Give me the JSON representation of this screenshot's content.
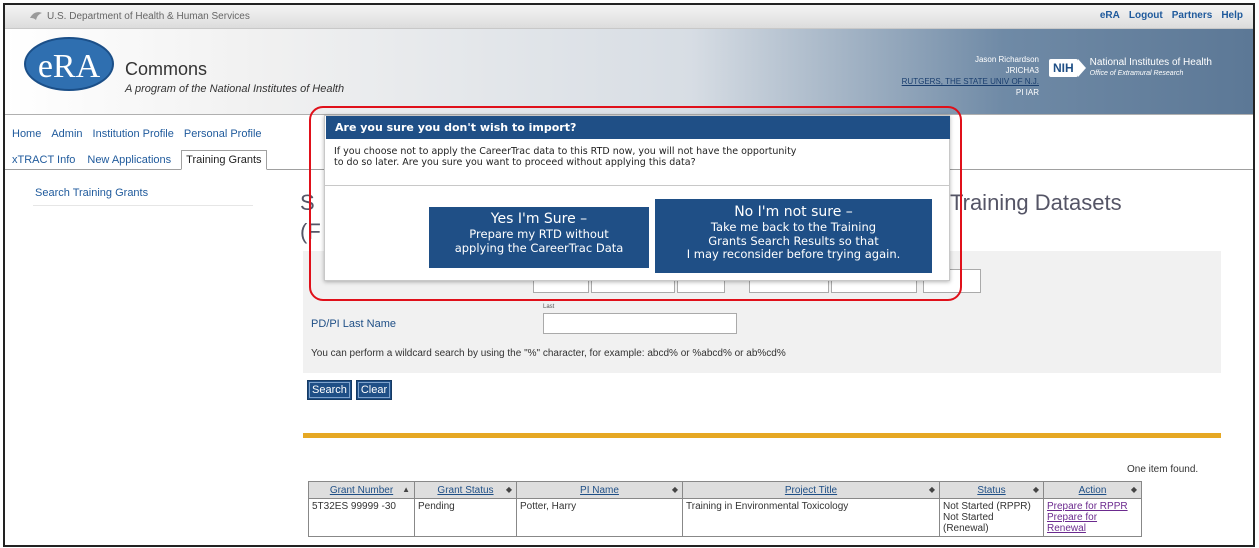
{
  "top_bar": {
    "hhs_label": "U.S. Department of Health & Human Services",
    "links": [
      "eRA",
      "Logout",
      "Partners",
      "Help"
    ]
  },
  "header": {
    "logo_text": "eRA",
    "title": "Commons",
    "subtitle": "A program of the National Institutes of Health",
    "user_name": "Jason Richardson",
    "user_id": "JRICHA3",
    "user_org": "RUTGERS, THE STATE UNIV OF N.J.",
    "user_roles": "PI IAR",
    "nih_badge": "NIH",
    "nih_name": "National Institutes of Health",
    "nih_office": "Office of Extramural Research"
  },
  "nav_main": [
    "Home",
    "Admin",
    "Institution Profile",
    "Personal Profile"
  ],
  "nav_sub": [
    "xTRACT Info",
    "New Applications",
    "Training Grants"
  ],
  "nav_sub_active": "Training Grants",
  "sidebar": {
    "link": "Search Training Grants"
  },
  "page": {
    "title_left": "S",
    "title_left2": "(F",
    "title_right": "Training Datasets"
  },
  "search": {
    "last_label": "Last",
    "pdpi_label": "PD/PI Last Name",
    "pdpi_value": "",
    "wildcard_hint": "You can perform a wildcard search by using the \"%\" character, for example: abcd% or %abcd% or ab%cd%",
    "search_button": "Search",
    "clear_button": "Clear"
  },
  "results": {
    "count_text": "One item found.",
    "columns": [
      "Grant Number",
      "Grant Status",
      "PI Name",
      "Project Title",
      "Status",
      "Action"
    ],
    "column_sort_glyphs": [
      "▲",
      "◆",
      "◆",
      "◆",
      "◆",
      "◆"
    ],
    "rows": [
      {
        "grant_number": "5T32ES 99999 -30",
        "grant_status": "Pending",
        "pi_name": "Potter, Harry",
        "project_title": "Training in Environmental Toxicology",
        "status_1": "Not Started (RPPR)",
        "status_2": "Not Started (Renewal)",
        "action_1": "Prepare for RPPR",
        "action_2": "Prepare for Renewal"
      }
    ]
  },
  "modal": {
    "title": "Are you sure you don't wish to import?",
    "message_line1": "If you choose not to apply the CareerTrac data to this RTD now, you will not have the opportunity",
    "message_line2": "to do so later. Are you sure you want to proceed without applying this data?",
    "yes_button": {
      "line1": "Yes I'm Sure –",
      "line2": "Prepare my RTD without",
      "line3": "applying the CareerTrac Data"
    },
    "no_button": {
      "line1": "No I'm not sure –",
      "line2": "Take me back to the Training",
      "line3": "Grants Search Results so that",
      "line4": "I may reconsider before trying again."
    }
  },
  "colors": {
    "brand_blue": "#1f4f86",
    "link_blue": "#1f5a9c",
    "accent_gold": "#e6a823",
    "highlight_red": "#e0101a"
  }
}
